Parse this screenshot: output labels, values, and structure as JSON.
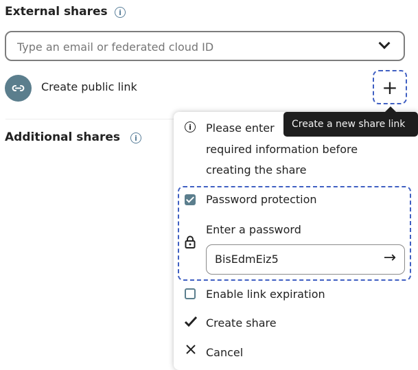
{
  "external_shares": {
    "heading": "External shares",
    "search_placeholder": "Type an email or federated cloud ID"
  },
  "public_link": {
    "label": "Create public link"
  },
  "tooltip": "Create a new share link",
  "additional_shares": {
    "heading": "Additional shares"
  },
  "popover": {
    "info_lines": [
      "Please enter the",
      "required information before",
      "creating the share"
    ],
    "info_line1": "Please enter",
    "info_line2": "required information before",
    "info_line3": "creating the share",
    "password_protection_label": "Password protection",
    "password_protection_checked": true,
    "password_field_label": "Enter a password",
    "password_value": "BisEdmEiz5",
    "link_expiration_label": "Enable link expiration",
    "link_expiration_checked": false,
    "create_share_label": "Create share",
    "cancel_label": "Cancel"
  },
  "colors": {
    "accent": "#5b7e8d",
    "focus_outline": "#3f5fc2",
    "tooltip_bg": "#1e1e1e"
  }
}
